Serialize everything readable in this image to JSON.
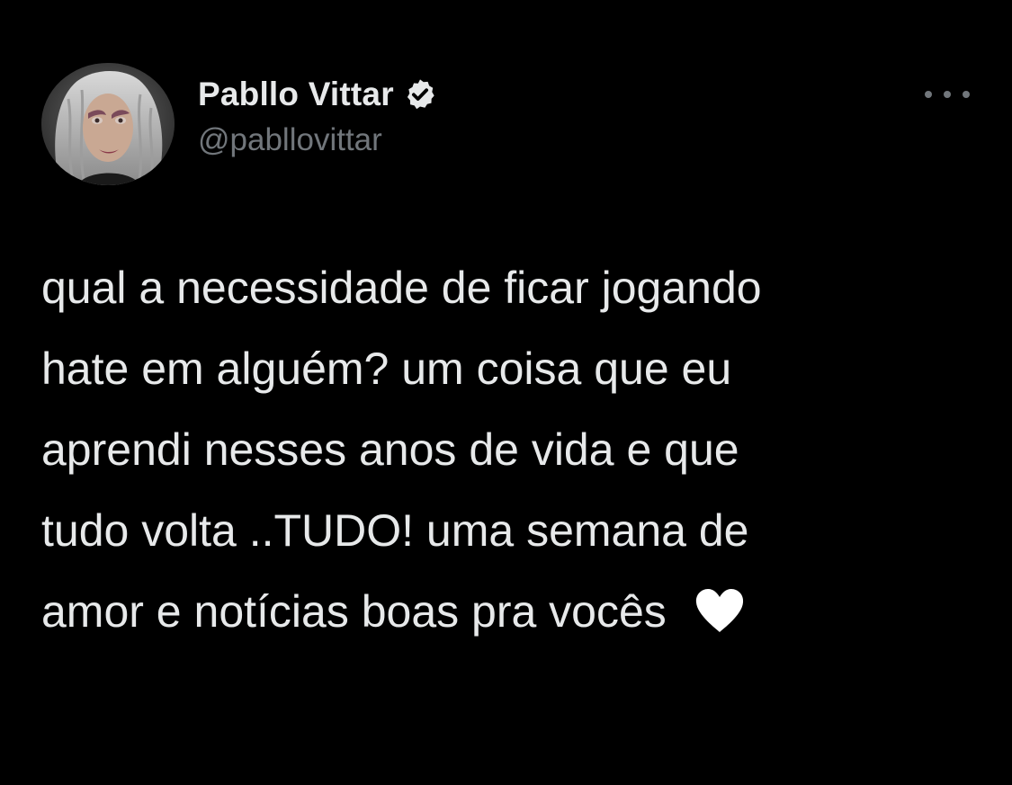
{
  "tweet": {
    "author": {
      "display_name": "Pabllo Vittar",
      "handle": "@pabllovittar",
      "verified": true,
      "verified_icon": "verified-badge-icon",
      "avatar_icon": "avatar"
    },
    "more_icon": "more-options-icon",
    "text_lines": [
      "qual a necessidade de ficar jogando",
      "hate em alguém? um coisa que eu",
      "aprendi nesses anos de vida e que",
      "tudo volta ..TUDO! uma semana de",
      "amor e notícias boas pra vocês"
    ],
    "trailing_emoji": "white-heart-icon"
  },
  "colors": {
    "background": "#000000",
    "primary_text": "#e7e9ea",
    "secondary_text": "#71767b"
  }
}
